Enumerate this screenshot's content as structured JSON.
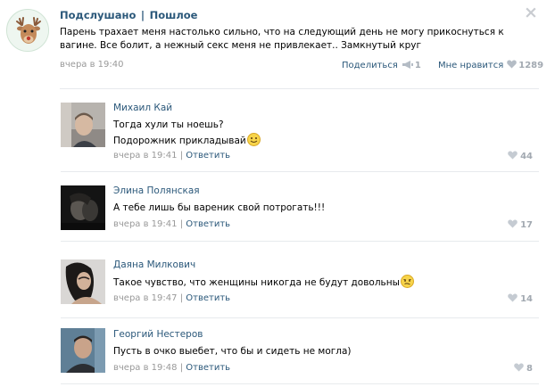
{
  "post": {
    "group_name": "Подслушано",
    "separator": "|",
    "category": "Пошлое",
    "text": "Парень трахает меня настолько сильно, что на следующий день не могу прикоснуться к вагине. Все болит, а нежный секс меня не привлекает.. Замкнутый круг",
    "time": "вчера в 19:40",
    "share_label": "Поделиться",
    "share_count": "1",
    "dislike_label": "Мне нравится",
    "like_count": "1289",
    "close_icon": "×"
  },
  "comments": [
    {
      "author": "Михаил Кай",
      "lines": [
        "Тогда хули ты ноешь?",
        "Подорожник прикладывай"
      ],
      "emoji": "smile-emoji",
      "time": "вчера в 19:41",
      "sep": "|",
      "reply": "Ответить",
      "likes": "44"
    },
    {
      "author": "Элина Полянская",
      "lines": [
        "А тебе лишь бы вареник свой потрогать!!!"
      ],
      "time": "вчера в 19:41",
      "sep": "|",
      "reply": "Ответить",
      "likes": "17"
    },
    {
      "author": "Даяна Милкович",
      "lines": [
        "Такое чувство, что женщины никогда не будут довольны"
      ],
      "emoji": "wry-emoji",
      "time": "вчера в 19:47",
      "sep": "|",
      "reply": "Ответить",
      "likes": "14"
    },
    {
      "author": "Георгий Нестеров",
      "lines": [
        "Пусть в очко выебет, что бы и сидеть не могла)"
      ],
      "time": "вчера в 19:48",
      "sep": "|",
      "reply": "Ответить",
      "likes": "8"
    }
  ],
  "colors": {
    "link": "#2b587a",
    "muted": "#999999",
    "count": "#a2a9b1",
    "divider": "#e7eaed"
  }
}
